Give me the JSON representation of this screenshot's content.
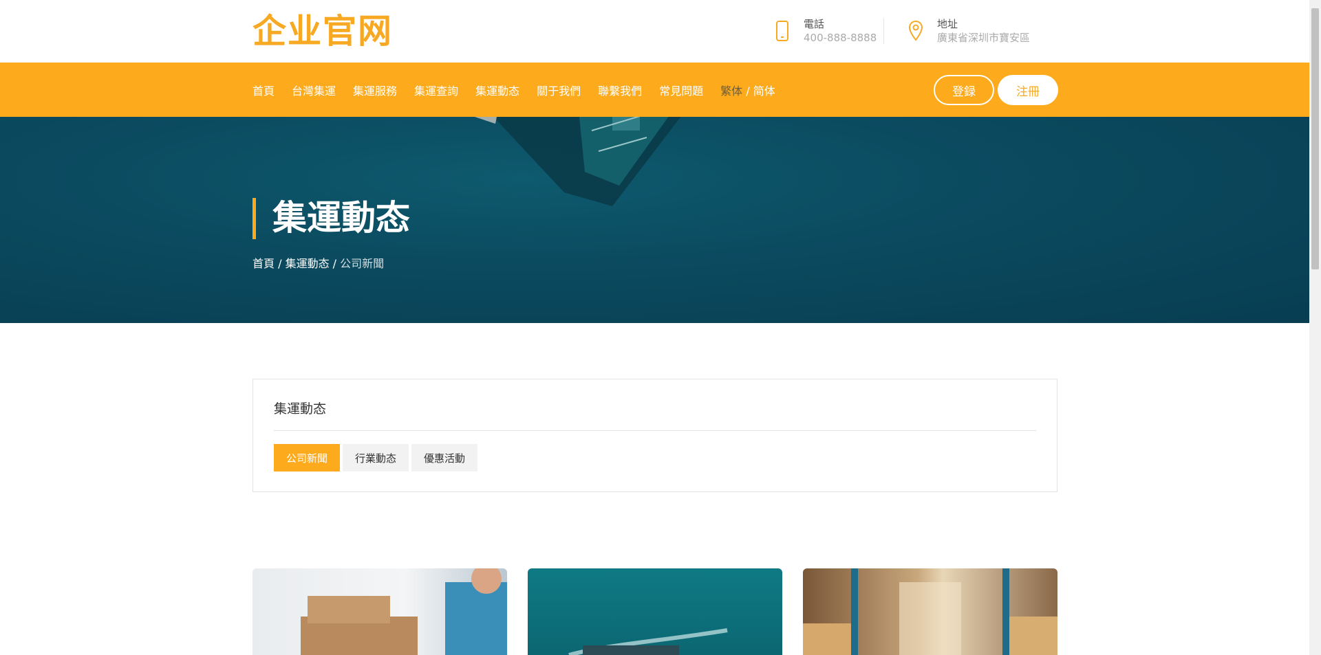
{
  "header": {
    "logo": "企业官网",
    "phone_label": "電話",
    "phone_value": "400-888-8888",
    "address_label": "地址",
    "address_value": "廣東省深圳市寶安區"
  },
  "nav": {
    "items": [
      "首頁",
      "台灣集運",
      "集運服務",
      "集運查詢",
      "集運動态",
      "關于我們",
      "聯繫我們",
      "常見問題"
    ],
    "lang_trad": "繁体",
    "lang_sep": " / ",
    "lang_simp": "简体",
    "login": "登録",
    "register": "注冊"
  },
  "hero": {
    "title": "集運動态",
    "breadcrumb": [
      "首頁",
      "集運動态",
      "公司新聞"
    ],
    "breadcrumb_sep": " / "
  },
  "category": {
    "title": "集運動态",
    "tabs": [
      {
        "label": "公司新聞",
        "active": true
      },
      {
        "label": "行業動态",
        "active": false
      },
      {
        "label": "優惠活動",
        "active": false
      }
    ]
  },
  "colors": {
    "accent": "#fdab1d",
    "logo": "#f7a924",
    "hero_bg": "#0b4b60"
  },
  "icons": {
    "phone": "mobile-phone-icon",
    "address": "map-pin-icon"
  }
}
